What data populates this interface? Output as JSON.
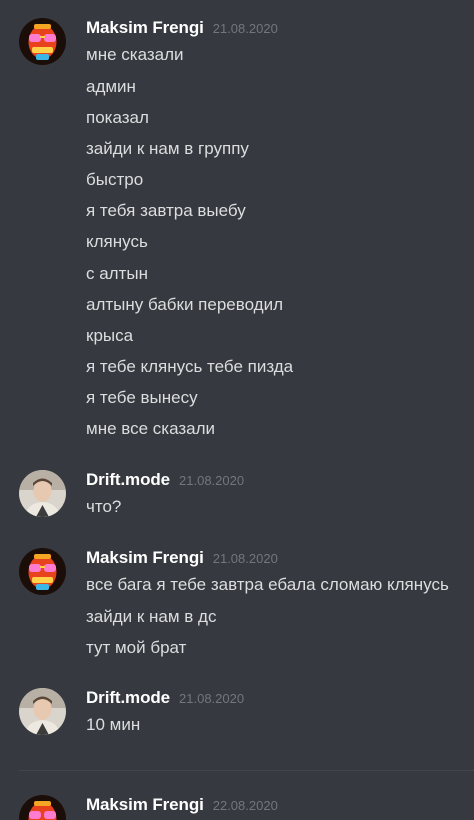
{
  "groups": [
    {
      "author": "Maksim Frengi",
      "timestamp": "21.08.2020",
      "avatar": "maksim-avatar",
      "lines": [
        "мне сказали",
        "админ",
        "показал",
        "зайди к нам в группу",
        "быстро",
        "я тебя завтра выебу",
        "клянусь",
        "с алтын",
        "алтыну бабки переводил",
        "крыса",
        "я тебе клянусь тебе пизда",
        "я тебе вынесу",
        "мне все сказали"
      ]
    },
    {
      "author": "Drift.mode",
      "timestamp": "21.08.2020",
      "avatar": "drift-avatar",
      "lines": [
        "что?"
      ]
    },
    {
      "author": "Maksim Frengi",
      "timestamp": "21.08.2020",
      "avatar": "maksim-avatar",
      "lines": [
        "все бага я тебе завтра ебала сломаю клянусь",
        "зайди к нам в дс",
        "тут мой брат"
      ]
    },
    {
      "author": "Drift.mode",
      "timestamp": "21.08.2020",
      "avatar": "drift-avatar",
      "lines": [
        "10 мин"
      ]
    },
    {
      "author": "Maksim Frengi",
      "timestamp": "22.08.2020",
      "avatar": "maksim-avatar",
      "lines": []
    }
  ],
  "colors": {
    "background": "#36393f",
    "username": "#ffffff",
    "timestamp": "#72767d",
    "text": "#dcddde"
  }
}
